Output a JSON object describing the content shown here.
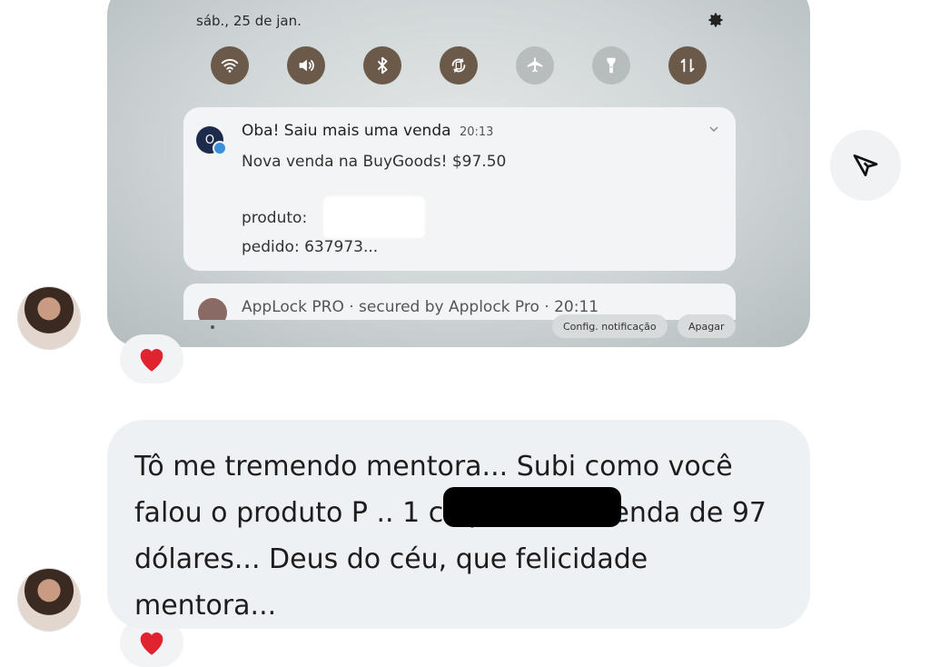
{
  "screenshot_message": {
    "date": "sáb., 25 de jan.",
    "quick_settings": [
      {
        "icon": "wifi-icon",
        "active": true
      },
      {
        "icon": "volume-icon",
        "active": true
      },
      {
        "icon": "bluetooth-icon",
        "active": true
      },
      {
        "icon": "auto-rotate-icon",
        "active": true
      },
      {
        "icon": "airplane-icon",
        "active": false
      },
      {
        "icon": "flashlight-icon",
        "active": false
      },
      {
        "icon": "data-transfer-icon",
        "active": true
      }
    ],
    "notification": {
      "avatar_letter": "O",
      "title": "Oba! Saiu mais uma venda",
      "time": "20:13",
      "line1": "Nova venda na BuyGoods! $97.50",
      "line2": "produto:",
      "line3": "pedido: 637973..."
    },
    "notification2": {
      "text": "AppLock PRO · secured by Applock Pro · 20:11"
    },
    "buttons": {
      "settings": "Config. notificação",
      "clear": "Apagar"
    }
  },
  "chat": {
    "message_text": "Tô me tremendo mentora... Subi como você falou o produto P            .. 1 clique, uma venda de 97 dólares... Deus do céu, que felicidade mentora..."
  },
  "colors": {
    "qs_active": "#6b5a4a",
    "qs_inactive": "#b7bcbc",
    "bubble": "#eef1f3",
    "heart": "#e0242f"
  }
}
